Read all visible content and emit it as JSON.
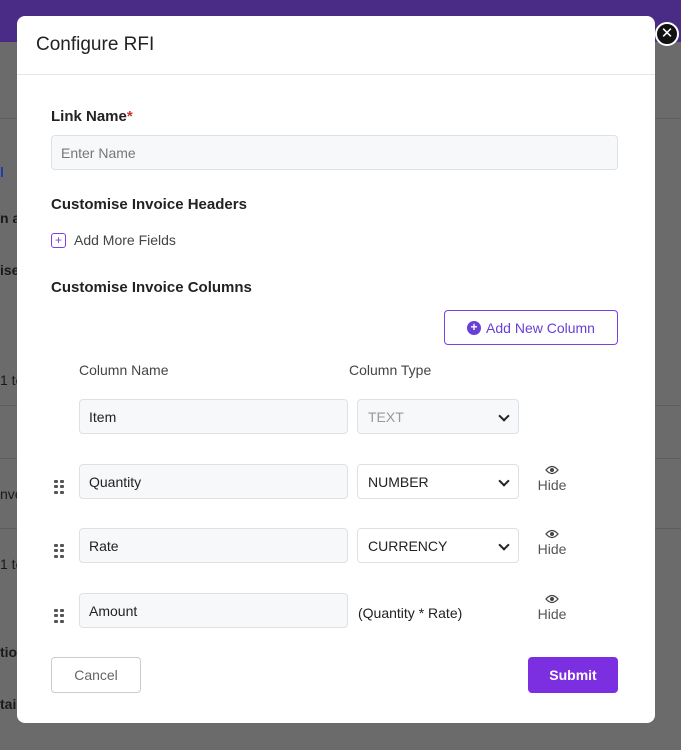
{
  "background": {
    "fragments": [
      "l",
      "n a",
      "ise",
      "1 te",
      "nve",
      "1 te",
      "tion",
      "tai"
    ]
  },
  "modal": {
    "title": "Configure RFI",
    "close_icon": "close-icon"
  },
  "link_name": {
    "label": "Link Name",
    "required_mark": "*",
    "placeholder": "Enter Name",
    "value": ""
  },
  "headers_section": {
    "title": "Customise Invoice Headers",
    "add_fields_label": "Add More Fields"
  },
  "columns_section": {
    "title": "Customise Invoice Columns",
    "add_column_label": "Add New Column",
    "col_name_header": "Column Name",
    "col_type_header": "Column Type",
    "rows": [
      {
        "name": "Item",
        "type": "TEXT",
        "hide_label": ""
      },
      {
        "name": "Quantity",
        "type": "NUMBER",
        "hide_label": "Hide"
      },
      {
        "name": "Rate",
        "type": "CURRENCY",
        "hide_label": "Hide"
      },
      {
        "name": "Amount",
        "type": "(Quantity * Rate)",
        "hide_label": "Hide"
      }
    ]
  },
  "actions": {
    "cancel": "Cancel",
    "submit": "Submit"
  },
  "colors": {
    "accent": "#7b2fe0",
    "topbar": "#4a2b85"
  }
}
